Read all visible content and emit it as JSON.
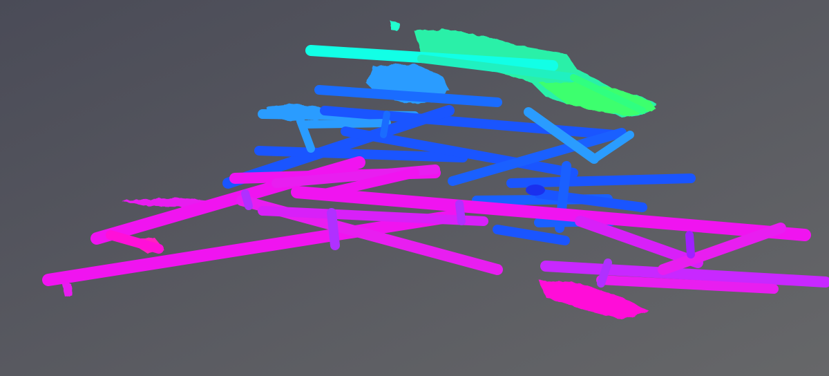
{
  "viewport": {
    "background_top": "#4a4b57",
    "background_bottom": "#666769",
    "gradient_low": "#ff10f0",
    "gradient_mid_low": "#a020ff",
    "gradient_mid": "#1a55ff",
    "gradient_mid_high": "#22b8ff",
    "gradient_high": "#10ffd0",
    "gradient_top": "#28ff70"
  }
}
